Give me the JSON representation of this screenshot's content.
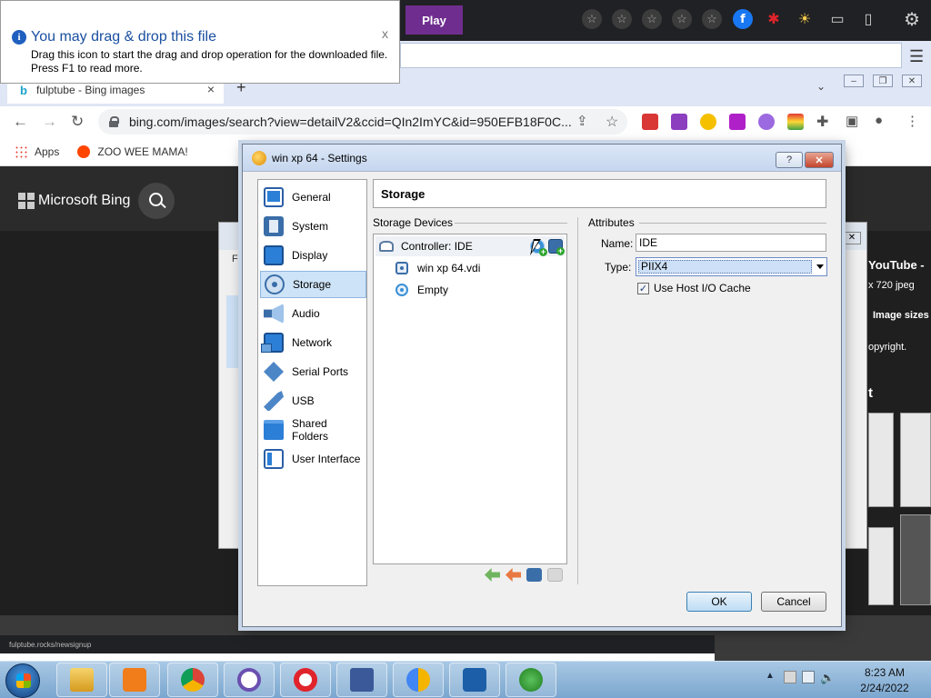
{
  "tooltip": {
    "title": "You may drag & drop this file",
    "body": "Drag this icon to start the drag and drop operation for the downloaded file. Press F1 to read more.",
    "close": "x"
  },
  "topbar": {
    "play": "Play"
  },
  "chrome": {
    "tab_title": "fulptube - Bing images",
    "tab_close": "×",
    "new_tab": "+",
    "url": "bing.com/images/search?view=detailV2&ccid=QIn2ImYC&id=950EFB18F0C...",
    "bookmarks": [
      "Apps",
      "ZOO WEE MAMA!"
    ]
  },
  "bing": {
    "logo": "Microsoft Bing",
    "side_title": "YouTube - ",
    "side_meta": "x 720 jpeg",
    "image_sizes": "Image sizes",
    "copyright": "opyright.",
    "letter": "t"
  },
  "bottom_url": "fulptube.rocks/newsignup",
  "dialog": {
    "title": "win xp 64 - Settings",
    "help": "?",
    "categories": [
      "General",
      "System",
      "Display",
      "Storage",
      "Audio",
      "Network",
      "Serial Ports",
      "USB",
      "Shared Folders",
      "User Interface"
    ],
    "selected_category": "Storage",
    "section_title": "Storage",
    "storage_devices_label": "Storage Devices",
    "attributes_label": "Attributes",
    "tree": {
      "controller": "Controller: IDE",
      "children": [
        "win xp 64.vdi",
        "Empty"
      ]
    },
    "attributes": {
      "name_label": "Name:",
      "name_value": "IDE",
      "type_label": "Type:",
      "type_value": "PIIX4",
      "cache_label": "Use Host I/O Cache",
      "cache_checked": "✓"
    },
    "ok": "OK",
    "cancel": "Cancel"
  },
  "taskbar": {
    "time": "8:23 AM",
    "date": "2/24/2022"
  },
  "colors": {
    "accent_blue": "#1a4fa0",
    "play_purple": "#6f2e8f",
    "selection": "#cde3f7",
    "taskbar": "#7aa6cf"
  }
}
